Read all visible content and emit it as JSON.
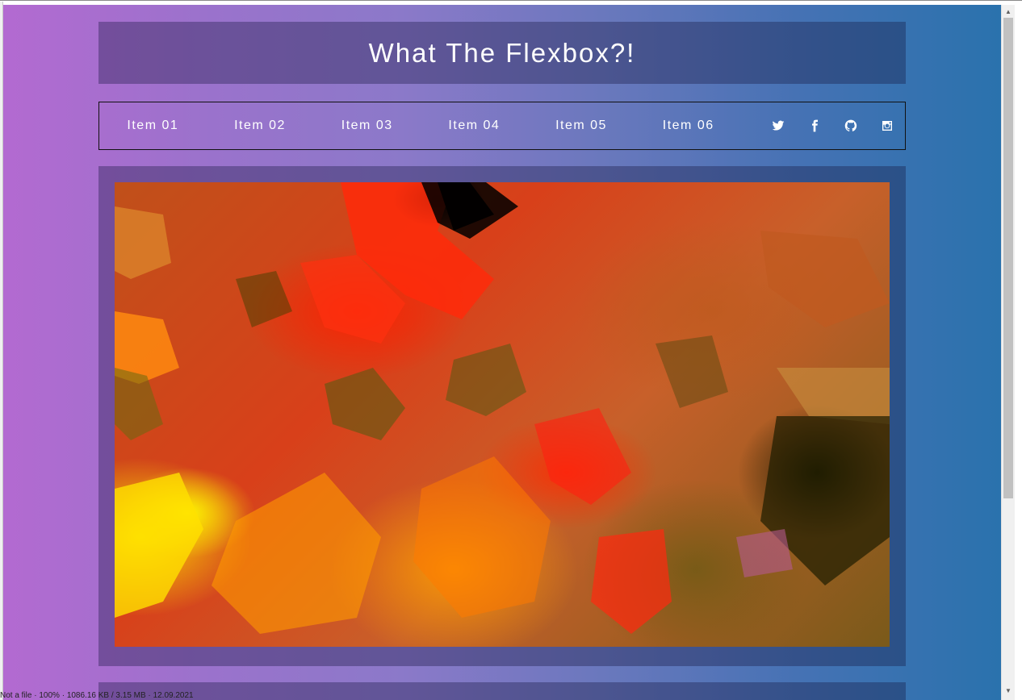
{
  "header": {
    "title": "What The Flexbox?!"
  },
  "nav": {
    "items": [
      {
        "label": "Item 01"
      },
      {
        "label": "Item 02"
      },
      {
        "label": "Item 03"
      },
      {
        "label": "Item 04"
      },
      {
        "label": "Item 05"
      },
      {
        "label": "Item 06"
      }
    ],
    "social_icons": [
      "twitter-icon",
      "facebook-icon",
      "github-icon",
      "instagram-icon"
    ]
  },
  "hero": {
    "image_icon": "abstract-satellite-image"
  },
  "status_bar": {
    "text": "Not a file · 100% · 1086.16 KB / 3.15 MB · 12.09.2021"
  },
  "colors": {
    "gradient_left": "#b36ad1",
    "gradient_right": "#2a72ad",
    "panel_overlay": "rgba(20,20,60,0.35)",
    "text": "#ffffff"
  }
}
